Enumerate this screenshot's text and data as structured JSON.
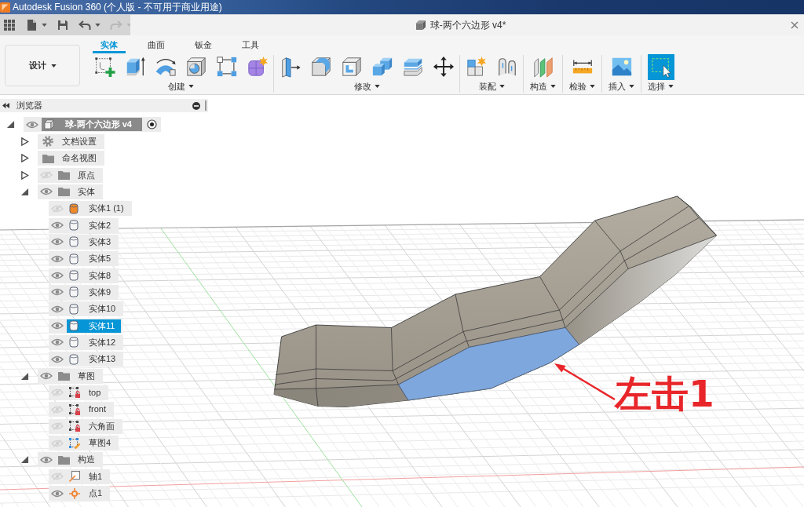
{
  "window": {
    "title": "Autodesk Fusion 360 (个人版 - 不可用于商业用途)"
  },
  "quick_access": [
    {
      "kind": "apps",
      "menu": false,
      "disabled": false
    },
    {
      "kind": "file",
      "menu": true,
      "disabled": false
    },
    {
      "kind": "save",
      "menu": false,
      "disabled": false
    },
    {
      "kind": "undo",
      "menu": true,
      "disabled": false
    },
    {
      "kind": "redo",
      "menu": true,
      "disabled": true
    }
  ],
  "document_tab": {
    "title": "球-两个六边形 v4*"
  },
  "workspace": {
    "label": "设计"
  },
  "toolbar": {
    "tabs": [
      {
        "label": "实体",
        "selected": true
      },
      {
        "label": "曲面",
        "selected": false
      },
      {
        "label": "钣金",
        "selected": false
      },
      {
        "label": "工具",
        "selected": false
      }
    ],
    "groups": [
      {
        "label": "创建",
        "tools": [
          {
            "kind": "sketch",
            "active": false
          },
          {
            "kind": "extrude",
            "active": false
          },
          {
            "kind": "revolve",
            "active": false
          },
          {
            "kind": "hole",
            "active": false
          },
          {
            "kind": "pattern",
            "active": false
          },
          {
            "kind": "form",
            "active": false
          }
        ]
      },
      {
        "label": "修改",
        "tools": [
          {
            "kind": "presspull",
            "active": false
          },
          {
            "kind": "fillet",
            "active": false
          },
          {
            "kind": "shell",
            "active": false
          },
          {
            "kind": "combine",
            "active": false
          },
          {
            "kind": "offset",
            "active": false
          },
          {
            "kind": "move",
            "active": false
          }
        ]
      },
      {
        "label": "装配",
        "tools": [
          {
            "kind": "component",
            "active": false
          },
          {
            "kind": "joint",
            "active": false
          }
        ]
      },
      {
        "label": "构造",
        "tools": [
          {
            "kind": "plane",
            "active": false
          }
        ]
      },
      {
        "label": "检验",
        "tools": [
          {
            "kind": "measure",
            "active": false
          }
        ]
      },
      {
        "label": "插入",
        "tools": [
          {
            "kind": "image",
            "active": false
          }
        ]
      },
      {
        "label": "选择",
        "tools": [
          {
            "kind": "select",
            "active": true
          }
        ]
      }
    ]
  },
  "browser": {
    "title": "浏览器",
    "tree": [
      {
        "label": "球-两个六边形 v4",
        "kind": "document",
        "visible": true,
        "expanded": true,
        "active": true,
        "selected": false,
        "children": [
          {
            "label": "文档设置",
            "kind": "settings",
            "expanded": false,
            "selected": false
          },
          {
            "label": "命名视图",
            "kind": "folder",
            "expanded": false,
            "selected": false
          },
          {
            "label": "原点",
            "kind": "folder",
            "visible": false,
            "expanded": false,
            "selected": false
          },
          {
            "label": "实体",
            "kind": "folder",
            "visible": true,
            "expanded": true,
            "selected": false,
            "children": [
              {
                "label": "实体1 (1)",
                "kind": "body",
                "color": "#f0892a",
                "visible": false,
                "selected": false
              },
              {
                "label": "实体2",
                "kind": "body",
                "color": "#f6f6f6",
                "visible": true,
                "selected": false
              },
              {
                "label": "实体3",
                "kind": "body",
                "color": "#f6f6f6",
                "visible": true,
                "selected": false
              },
              {
                "label": "实体5",
                "kind": "body",
                "color": "#f6f6f6",
                "visible": true,
                "selected": false
              },
              {
                "label": "实体8",
                "kind": "body",
                "color": "#f6f6f6",
                "visible": true,
                "selected": false
              },
              {
                "label": "实体9",
                "kind": "body",
                "color": "#f6f6f6",
                "visible": true,
                "selected": false
              },
              {
                "label": "实体10",
                "kind": "body",
                "color": "#f6f6f6",
                "visible": true,
                "selected": false
              },
              {
                "label": "实体11",
                "kind": "body",
                "color": "#f6f6f6",
                "visible": true,
                "selected": true
              },
              {
                "label": "实体12",
                "kind": "body",
                "color": "#f6f6f6",
                "visible": true,
                "selected": false
              },
              {
                "label": "实体13",
                "kind": "body",
                "color": "#f6f6f6",
                "visible": true,
                "selected": false
              }
            ]
          },
          {
            "label": "草图",
            "kind": "folder",
            "visible": true,
            "expanded": true,
            "selected": false,
            "children": [
              {
                "label": "top",
                "kind": "sketch",
                "locked": true,
                "visible": false,
                "selected": false
              },
              {
                "label": "front",
                "kind": "sketch",
                "locked": true,
                "visible": false,
                "selected": false
              },
              {
                "label": "六角面",
                "kind": "sketch",
                "locked": true,
                "visible": false,
                "selected": false
              },
              {
                "label": "草图4",
                "kind": "sketch",
                "locked": false,
                "visible": false,
                "selected": false
              }
            ]
          },
          {
            "label": "构造",
            "kind": "folder",
            "visible": true,
            "expanded": true,
            "selected": false,
            "children": [
              {
                "label": "轴1",
                "kind": "axis",
                "visible": false,
                "selected": false
              },
              {
                "label": "点1",
                "kind": "point",
                "visible": true,
                "selected": false
              }
            ]
          }
        ]
      }
    ]
  },
  "viewport": {
    "annotation": "左击1"
  }
}
